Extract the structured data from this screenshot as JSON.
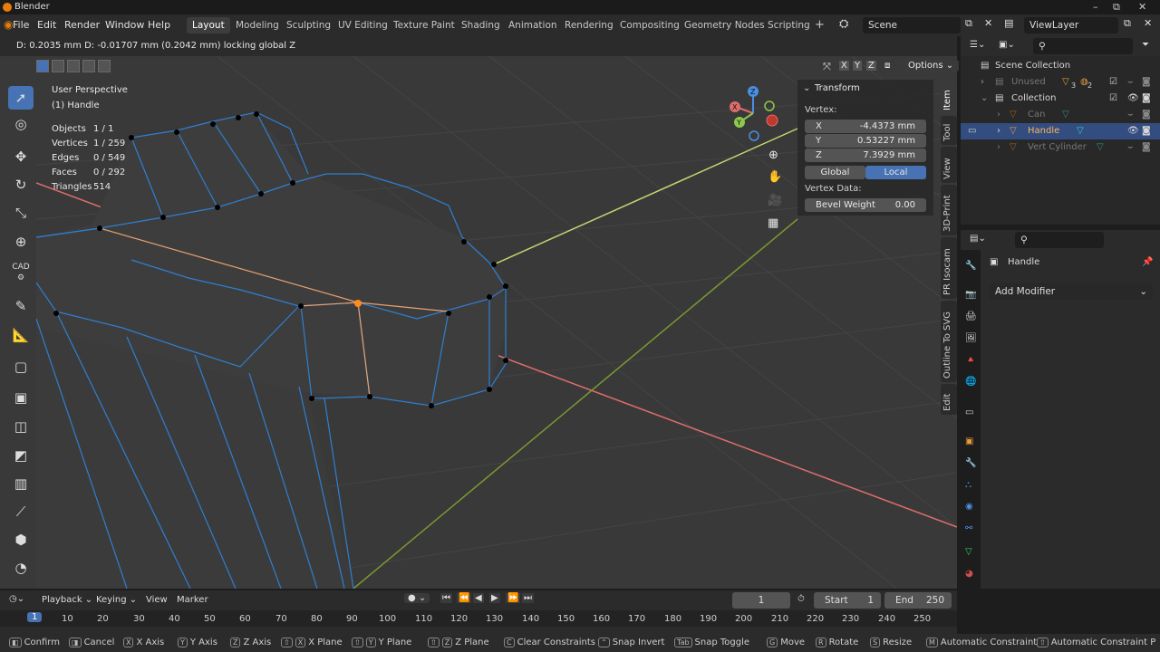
{
  "window": {
    "title": "Blender"
  },
  "menu": {
    "items": [
      "File",
      "Edit",
      "Render",
      "Window",
      "Help"
    ]
  },
  "workspaces": {
    "tabs": [
      "Layout",
      "Modeling",
      "Sculpting",
      "UV Editing",
      "Texture Paint",
      "Shading",
      "Animation",
      "Rendering",
      "Compositing",
      "Geometry Nodes",
      "Scripting"
    ],
    "active": "Layout",
    "add": "+"
  },
  "scene": {
    "name": "Scene"
  },
  "viewlayer": {
    "name": "ViewLayer"
  },
  "viewport_header": {
    "status_text": "D: 0.2035 mm   D: -0.01707 mm (0.2042 mm) locking global Z",
    "options_label": "Options",
    "axes": [
      "X",
      "Y",
      "Z"
    ]
  },
  "viewport": {
    "perspective": "User Perspective",
    "object": "(1) Handle",
    "stats": [
      {
        "label": "Objects",
        "value": "1 / 1"
      },
      {
        "label": "Vertices",
        "value": "1 / 259"
      },
      {
        "label": "Edges",
        "value": "0 / 549"
      },
      {
        "label": "Faces",
        "value": "0 / 292"
      },
      {
        "label": "Triangles",
        "value": "514"
      }
    ]
  },
  "toolbar": {
    "cad_label": "CAD"
  },
  "npanel": {
    "section": "Transform",
    "vertex_label": "Vertex:",
    "x_label": "X",
    "x_value": "-4.4373 mm",
    "y_label": "Y",
    "y_value": "0.53227 mm",
    "z_label": "Z",
    "z_value": "7.3929 mm",
    "global_label": "Global",
    "local_label": "Local",
    "vertex_data_label": "Vertex Data:",
    "bevel_label": "Bevel Weight",
    "bevel_value": "0.00",
    "tabs": [
      "Item",
      "Tool",
      "View",
      "3D-Print",
      "PR Isocam",
      "Outline To SVG",
      "Edit"
    ]
  },
  "outliner": {
    "scene_collection": "Scene Collection",
    "rows": [
      {
        "label": "Unused",
        "dim": true
      },
      {
        "label": "Collection",
        "dim": false
      },
      {
        "label": "Can",
        "dim": true
      },
      {
        "label": "Handle",
        "dim": false,
        "selected": true
      },
      {
        "label": "Vert Cylinder",
        "dim": true
      }
    ],
    "unused_badges": [
      "3",
      "2"
    ]
  },
  "properties": {
    "object_name": "Handle",
    "add_modifier": "Add Modifier"
  },
  "timeline": {
    "menus": [
      "Playback",
      "Keying",
      "View",
      "Marker"
    ],
    "current_frame": "1",
    "start_label": "Start",
    "start_value": "1",
    "end_label": "End",
    "end_value": "250",
    "ruler": [
      "1",
      "10",
      "20",
      "30",
      "40",
      "50",
      "60",
      "70",
      "80",
      "90",
      "100",
      "110",
      "120",
      "130",
      "140",
      "150",
      "160",
      "170",
      "180",
      "190",
      "200",
      "210",
      "220",
      "230",
      "240",
      "250"
    ]
  },
  "statusbar": {
    "items": [
      "Confirm",
      "Cancel",
      "X Axis",
      "Y Axis",
      "Z Axis",
      "X Plane",
      "Y Plane",
      "Z Plane",
      "Clear Constraints",
      "Snap Invert",
      "Snap Toggle",
      "Move",
      "Rotate",
      "Resize",
      "Automatic Constraint",
      "Automatic Constraint P"
    ]
  },
  "colors": {
    "accent": "#4772b3",
    "x_axis": "#e06c6c",
    "y_axis": "#b9c86a",
    "selected_vertex": "#ff8c1a",
    "edge_blue": "#2f7fd1"
  }
}
